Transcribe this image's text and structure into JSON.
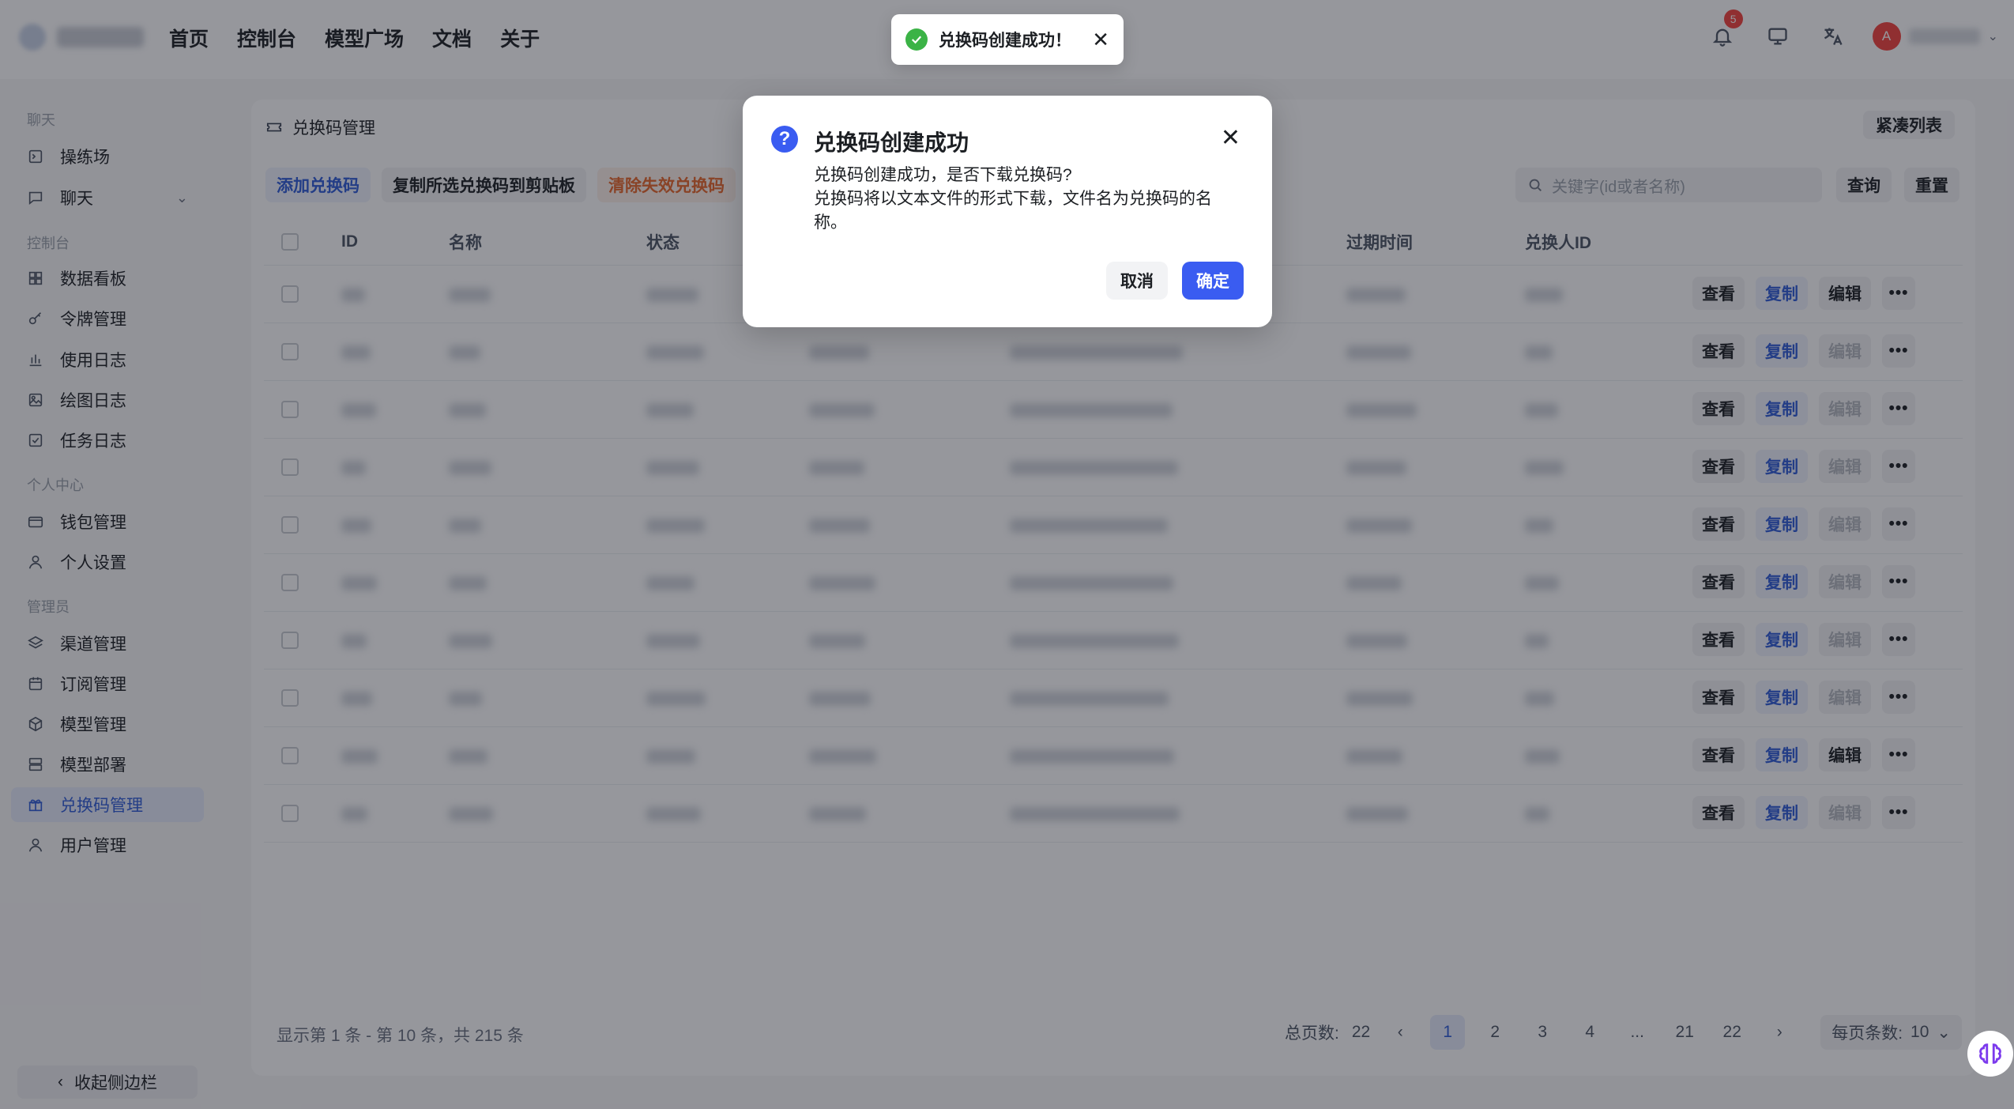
{
  "header": {
    "nav": [
      "首页",
      "控制台",
      "模型广场",
      "文档",
      "关于"
    ],
    "notification_count": "5",
    "avatar_letter": "A"
  },
  "sidebar": {
    "sections": [
      {
        "title": "聊天",
        "items": [
          {
            "label": "操练场",
            "icon": "playground-icon"
          },
          {
            "label": "聊天",
            "icon": "chat-icon",
            "expandable": true
          }
        ]
      },
      {
        "title": "控制台",
        "items": [
          {
            "label": "数据看板",
            "icon": "dashboard-icon"
          },
          {
            "label": "令牌管理",
            "icon": "key-icon"
          },
          {
            "label": "使用日志",
            "icon": "bar-chart-icon"
          },
          {
            "label": "绘图日志",
            "icon": "image-icon"
          },
          {
            "label": "任务日志",
            "icon": "task-icon"
          }
        ]
      },
      {
        "title": "个人中心",
        "items": [
          {
            "label": "钱包管理",
            "icon": "wallet-icon"
          },
          {
            "label": "个人设置",
            "icon": "user-icon"
          }
        ]
      },
      {
        "title": "管理员",
        "items": [
          {
            "label": "渠道管理",
            "icon": "layers-icon"
          },
          {
            "label": "订阅管理",
            "icon": "calendar-icon"
          },
          {
            "label": "模型管理",
            "icon": "cube-icon"
          },
          {
            "label": "模型部署",
            "icon": "server-icon"
          },
          {
            "label": "兑换码管理",
            "icon": "gift-icon",
            "active": true
          },
          {
            "label": "用户管理",
            "icon": "user-icon"
          }
        ]
      }
    ],
    "collapse_label": "收起侧边栏"
  },
  "main": {
    "title": "兑换码管理",
    "compact_label": "紧凑列表",
    "toolbar": {
      "add": "添加兑换码",
      "copy": "复制所选兑换码到剪贴板",
      "clear": "清除失效兑换码"
    },
    "search_placeholder": "关键字(id或者名称)",
    "query_label": "查询",
    "reset_label": "重置",
    "columns": {
      "id": "ID",
      "name": "名称",
      "status": "状态",
      "expire": "过期时间",
      "redeemer": "兑换人ID"
    },
    "actions": {
      "view": "查看",
      "copy": "复制",
      "edit": "编辑",
      "more": "•••"
    },
    "rows_edit_enabled": [
      true,
      false,
      false,
      false,
      false,
      false,
      false,
      false,
      true,
      false
    ],
    "footer_info": "显示第 1 条 - 第 10 条，共 215 条",
    "pagination": {
      "total_label": "总页数:",
      "total": "22",
      "pages": [
        "1",
        "2",
        "3",
        "4",
        "...",
        "21",
        "22"
      ],
      "current": "1",
      "page_size_label": "每页条数:",
      "page_size": "10"
    }
  },
  "toast": {
    "text": "兑换码创建成功！"
  },
  "modal": {
    "title": "兑换码创建成功",
    "line1": "兑换码创建成功，是否下载兑换码?",
    "line2": "兑换码将以文本文件的形式下载，文件名为兑换码的名称。",
    "cancel": "取消",
    "ok": "确定"
  },
  "colors": {
    "primary": "#3a5cf1",
    "accent_blue": "#2e5bd8",
    "danger": "#e8672a",
    "success": "#3bb346",
    "badge": "#f5433d"
  }
}
